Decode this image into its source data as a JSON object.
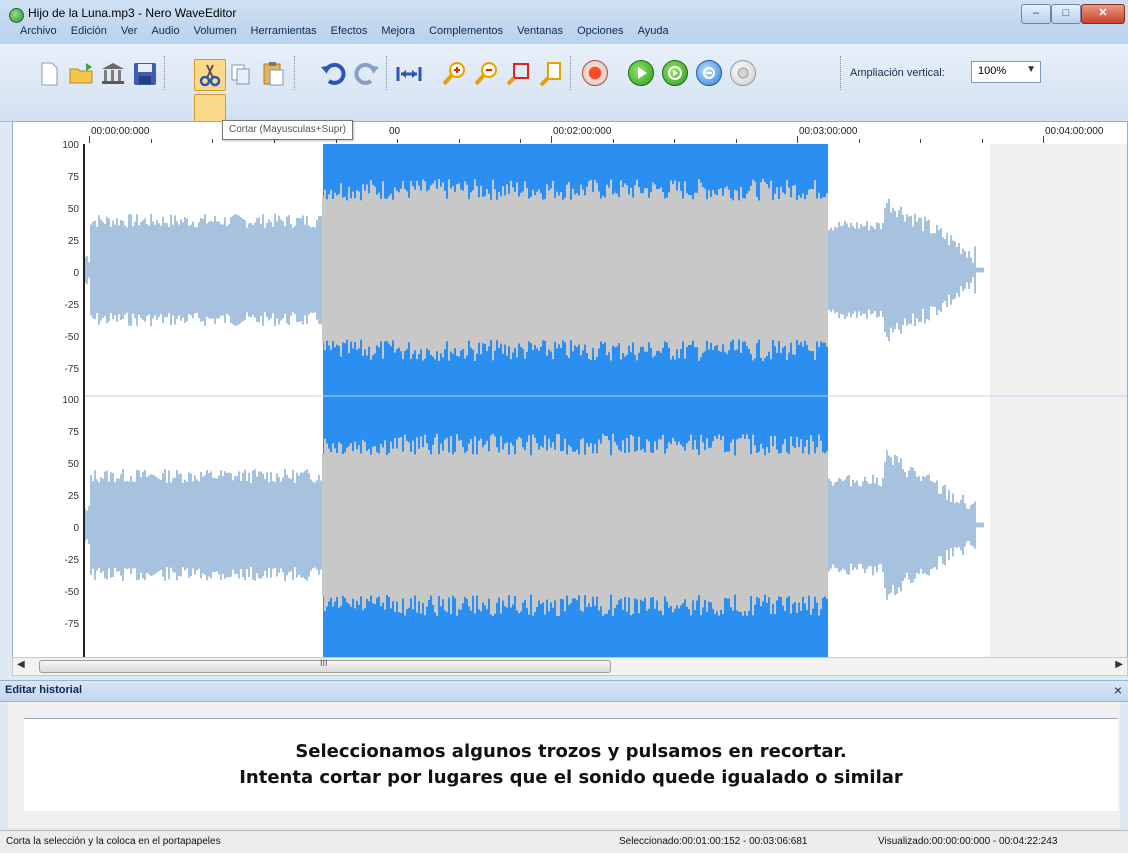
{
  "window": {
    "title": "Hijo de la Luna.mp3 - Nero WaveEditor"
  },
  "menu": [
    "Archivo",
    "Edición",
    "Ver",
    "Audio",
    "Volumen",
    "Herramientas",
    "Efectos",
    "Mejora",
    "Complementos",
    "Ventanas",
    "Opciones",
    "Ayuda"
  ],
  "toolbar": {
    "zoom_label": "Ampliación vertical:",
    "zoom_value": "100%",
    "tooltip": "Cortar (Mayusculas+Supr)"
  },
  "ruler": {
    "labels": [
      "00:00:00:000",
      "00",
      "00:02:00:000",
      "00:03:00:000",
      "00:04:00:000"
    ]
  },
  "y_axis": {
    "labels": [
      "100",
      "75",
      "50",
      "25",
      "0",
      "-25",
      "-50",
      "-75"
    ]
  },
  "scrollbar": {
    "grip": "III"
  },
  "colors": {
    "selection": "#2a8ff0",
    "wave": "#a7c2df",
    "wave_selected": "#c8c8c8"
  },
  "history_panel": {
    "title": "Editar historial",
    "close": "×",
    "line1": "Seleccionamos algunos trozos y pulsamos en recortar.",
    "line2": "Intenta cortar por lugares que el sonido quede igualado o similar"
  },
  "status": {
    "left": "Corta la selección y la coloca en el portapapeles",
    "selected": "Seleccionado:00:01:00:152 - 00:03:06:681",
    "visible": "Visualizado:00:00:00:000 - 00:04:22:243"
  }
}
